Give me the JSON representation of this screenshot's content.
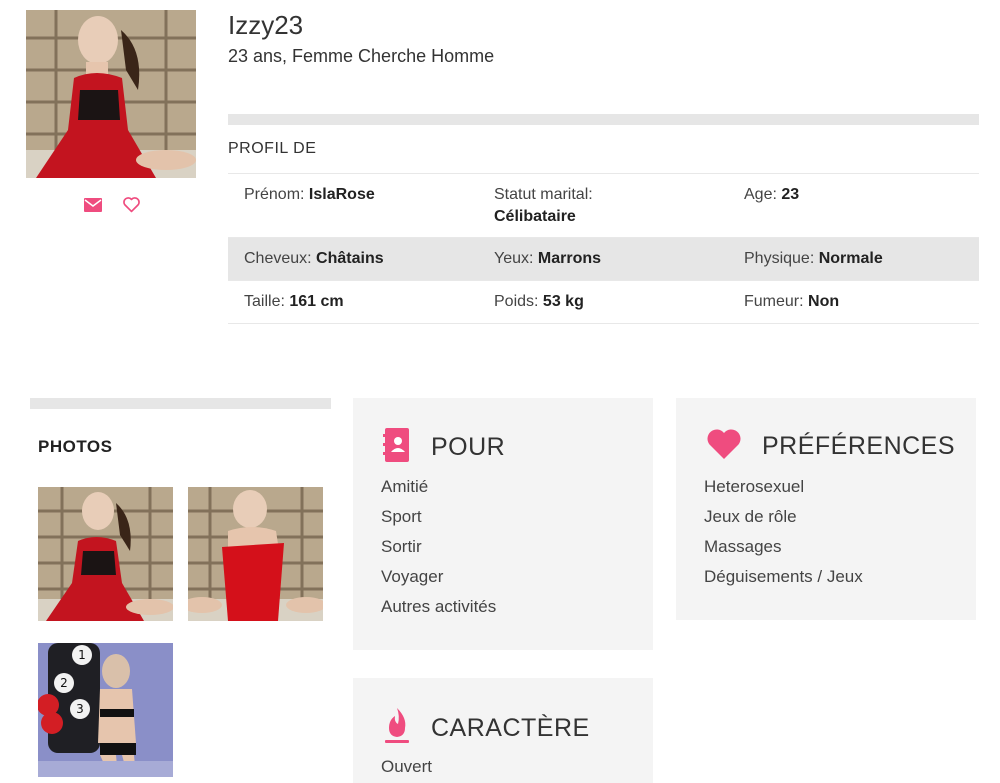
{
  "profile": {
    "username": "Izzy23",
    "subtitle": "23 ans, Femme Cherche Homme",
    "actions": {
      "message_icon": "envelope-icon",
      "favorite_icon": "heart-outline-icon"
    }
  },
  "profile_section": {
    "title": "PROFIL DE",
    "rows": [
      [
        {
          "label": "Prénom:",
          "value": "IslaRose"
        },
        {
          "label": "Statut marital:",
          "value": "Célibataire"
        },
        {
          "label": "Age:",
          "value": "23"
        }
      ],
      [
        {
          "label": "Cheveux:",
          "value": "Châtains"
        },
        {
          "label": "Yeux:",
          "value": "Marrons"
        },
        {
          "label": "Physique:",
          "value": "Normale"
        }
      ],
      [
        {
          "label": "Taille:",
          "value": "161 cm"
        },
        {
          "label": "Poids:",
          "value": "53 kg"
        },
        {
          "label": "Fumeur:",
          "value": "Non"
        }
      ]
    ]
  },
  "photos": {
    "title": "PHOTOS"
  },
  "pour": {
    "icon": "address-book-icon",
    "title": "POUR",
    "items": [
      "Amitié",
      "Sport",
      "Sortir",
      "Voyager",
      "Autres activités"
    ]
  },
  "preferences": {
    "icon": "heart-icon",
    "title": "PRÉFÉRENCES",
    "items": [
      "Heterosexuel",
      "Jeux de rôle",
      "Massages",
      "Déguisements / Jeux"
    ]
  },
  "caractere": {
    "icon": "flame-icon",
    "title": "CARACTÈRE",
    "items": [
      "Ouvert"
    ]
  },
  "colors": {
    "accent": "#ef4c7f",
    "panel": "#f4f4f4",
    "bar": "#e6e6e6"
  }
}
